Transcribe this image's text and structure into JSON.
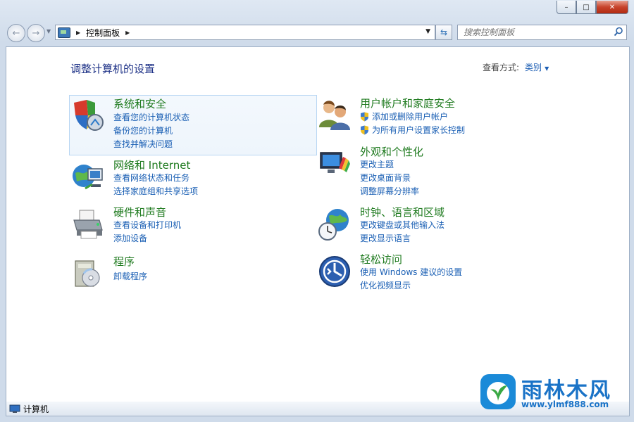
{
  "window": {
    "caption": {
      "minimize": "–",
      "maximize": "□",
      "close": "✕"
    }
  },
  "nav": {
    "back": "←",
    "forward": "→",
    "breadcrumb": "控制面板",
    "search_placeholder": "搜索控制面板"
  },
  "main": {
    "title": "调整计算机的设置",
    "view_by_label": "查看方式:",
    "view_by_value": "类别"
  },
  "categories": [
    {
      "title": "系统和安全",
      "links": [
        "查看您的计算机状态",
        "备份您的计算机",
        "查找并解决问题"
      ]
    },
    {
      "title": "网络和 Internet",
      "links": [
        "查看网络状态和任务",
        "选择家庭组和共享选项"
      ]
    },
    {
      "title": "硬件和声音",
      "links": [
        "查看设备和打印机",
        "添加设备"
      ]
    },
    {
      "title": "程序",
      "links": [
        "卸载程序"
      ]
    },
    {
      "title": "用户帐户和家庭安全",
      "links": [
        "添加或删除用户帐户",
        "为所有用户设置家长控制"
      ]
    },
    {
      "title": "外观和个性化",
      "links": [
        "更改主题",
        "更改桌面背景",
        "调整屏幕分辨率"
      ]
    },
    {
      "title": "时钟、语言和区域",
      "links": [
        "更改键盘或其他输入法",
        "更改显示语言"
      ]
    },
    {
      "title": "轻松访问",
      "links": [
        "使用 Windows 建议的设置",
        "优化视频显示"
      ]
    }
  ],
  "statusbar": {
    "label": "计算机"
  },
  "watermark": {
    "brand": "雨林木风",
    "url": "www.ylmf888.com"
  },
  "colors": {
    "link": "#1a5fb4",
    "category_title": "#1e7a1e",
    "page_title": "#1e3287"
  }
}
